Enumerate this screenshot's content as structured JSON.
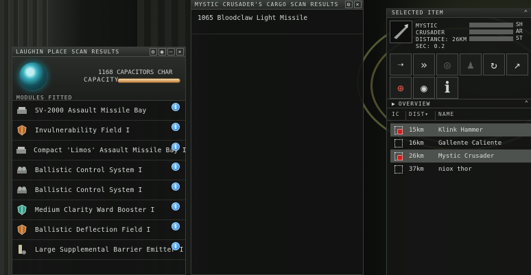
{
  "scan_window": {
    "title": "LAUGHIN PLACE SCAN RESULTS",
    "capacitor_text": "1168 CAPACITORS CHAR",
    "capacity_label": "CAPACITY",
    "modules_label": "MODULES FITTED",
    "capacitor_fill": 1.0,
    "modules": [
      {
        "name": "SV-2000 Assault Missile Bay",
        "icon": "missile-bay-icon"
      },
      {
        "name": "Invulnerability Field I",
        "icon": "shield-field-icon"
      },
      {
        "name": "Compact 'Limos' Assault Missile Bay I",
        "icon": "missile-bay-icon"
      },
      {
        "name": "Ballistic Control System I",
        "icon": "ballistic-control-icon"
      },
      {
        "name": "Ballistic Control System I",
        "icon": "ballistic-control-icon"
      },
      {
        "name": "Medium Clarity Ward Booster I",
        "icon": "shield-booster-icon"
      },
      {
        "name": "Ballistic Deflection Field I",
        "icon": "shield-field-icon"
      },
      {
        "name": "Large Supplemental Barrier Emitter I",
        "icon": "barrier-emitter-icon"
      }
    ]
  },
  "cargo_window": {
    "title": "MYSTIC CRUSADER'S CARGO SCAN RESULTS",
    "items": [
      "1065 Bloodclaw Light Missile"
    ]
  },
  "selected_item": {
    "title": "SELECTED ITEM",
    "name_line1": "MYSTIC",
    "name_line2": "CRUSADER",
    "distance": "DISTANCE: 26KM",
    "sec": "SEC: 0.2",
    "bars": [
      {
        "label": "SH"
      },
      {
        "label": "AR"
      },
      {
        "label": "ST"
      }
    ],
    "actions": [
      {
        "icon": "approach-icon",
        "glyph": "➝"
      },
      {
        "icon": "warp-icon",
        "glyph": "»"
      },
      {
        "icon": "orbit-icon",
        "glyph": "◎"
      },
      {
        "icon": "fleet-icon",
        "glyph": "♟"
      },
      {
        "icon": "keep-range-icon",
        "glyph": "↻"
      },
      {
        "icon": "align-icon",
        "glyph": "↗"
      },
      {
        "icon": "lock-target-icon",
        "glyph": "⊕"
      },
      {
        "icon": "look-at-icon",
        "glyph": "◉"
      },
      {
        "icon": "info-icon",
        "glyph": "i"
      }
    ]
  },
  "overview": {
    "title": "OVERVIEW",
    "columns": {
      "ic": "IC",
      "dist": "DIST",
      "name": "NAME"
    },
    "rows": [
      {
        "dist": "15km",
        "name": "Klink Hammer",
        "hostile": true,
        "highlight": true
      },
      {
        "dist": "16km",
        "name": "Gallente Caliente",
        "hostile": false,
        "highlight": false
      },
      {
        "dist": "26km",
        "name": "Mystic Crusader",
        "hostile": true,
        "highlight": true
      },
      {
        "dist": "37km",
        "name": "niox thor",
        "hostile": false,
        "highlight": false
      }
    ]
  }
}
